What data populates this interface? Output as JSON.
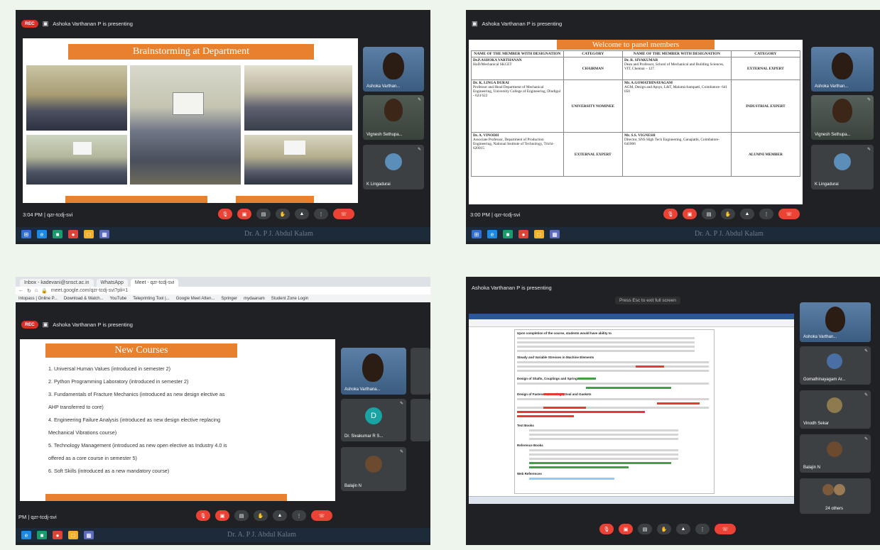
{
  "panel1": {
    "rec_label": "REC",
    "presenting": "Ashoka Varthanan P is presenting",
    "slide_title": "Brainstorming at Department",
    "participants": [
      {
        "name": "Ashoka Varthan..."
      },
      {
        "name": "Vignesh Sethupa..."
      },
      {
        "name": "K Lingadurai"
      }
    ],
    "time": "3:04 PM",
    "meeting_code": "qzr-tcdj-svi",
    "watermark": "Dr. A. P J. Abdul Kalam"
  },
  "panel2": {
    "presenting": "Ashoka Varthanan P is presenting",
    "slide_title": "Welcome to panel members",
    "headers": [
      "NAME OF THE MEMBER WITH DESIGNATION",
      "CATEGORY",
      "NAME OF THE MEMBER WITH DESIGNATION",
      "CATEGORY"
    ],
    "rows": [
      {
        "n1": "Dr.P.ASHOKA VARTHANAN",
        "d1": "HoD/Mechanical SKCET",
        "c1": "CHAIRMAN",
        "n2": "Dr. R. SIVAKUMAR",
        "d2": "Dean and Professor, School of Mechanical and Building Sciences, VIT, Chennai – 127.",
        "c2": "EXTERNAL EXPERT"
      },
      {
        "n1": "Dr. K. LINGA DURAI",
        "d1": "Professor and Head Department of Mechanical Engineering, University College of Engineering, Dindigul - 624 622",
        "c1": "UNIVERSITY NOMINEE",
        "n2": "Mr. A.GOMATHINAYAGAM",
        "d2": "AGM, Design and Apsys, L&T, Malumichampatti, Coimbatore- 641 050",
        "c2": "INDUSTRIAL EXPERT"
      },
      {
        "n1": "Dr. A. VINODH",
        "d1": "Associate Professor, Department of Production Engineering, National Institute of Technology, Trichi-620015",
        "c1": "EXTERNAL EXPERT",
        "n2": "Mr. S.S. VIGNESH",
        "d2": "Director, SNS High Tech Engineering, Ganapathi, Coimbatore- 641006",
        "c2": "ALUMNI MEMBER"
      }
    ],
    "participants": [
      {
        "name": "Ashoka Varthan..."
      },
      {
        "name": "Vignesh Sethupa..."
      },
      {
        "name": "K Lingadurai"
      }
    ],
    "time": "3:00 PM",
    "meeting_code": "qzr-tcdj-svi",
    "watermark": "Dr. A. P J. Abdul Kalam"
  },
  "panel3": {
    "tabs": [
      "Inbox - kadevani@snsct.ac.in",
      "WhatsApp",
      "Meet - qzr-tcdj-svi"
    ],
    "url": "meet.google.com/qzr-tcdj-svi?pli=1",
    "bookmarks": [
      "Intopass | Online P...",
      "Download & Watch...",
      "YouTube",
      "Teleprinting Tool |...",
      "Google Meet Atten...",
      "Springer",
      "mydaanam",
      "Student Zone Login"
    ],
    "rec_label": "REC",
    "presenting": "Ashoka Varthanan P is presenting",
    "slide_title": "New Courses",
    "courses": [
      "1.   Universal Human Values (introduced in semester 2)",
      "2.   Python Programming Laboratory (introduced in semester 2)",
      "3.   Fundamentals of Fracture Mechanics (introduced as new design elective as",
      "       AHP transferred to core)",
      "4.   Engineering Failure Analysis (introduced as new design elective replacing",
      "       Mechanical Vibrations course)",
      "5.   Technology Management (introduced as new open elective as Industry 4.0 is",
      "       offered as a core course in semester 5)",
      "6.   Soft Skills (introduced as a new mandatory course)"
    ],
    "participants": [
      {
        "name": "Ashoka Varthana..."
      },
      {
        "name": "Dr. Sivakumar R S..."
      },
      {
        "name": "Balajin N"
      }
    ],
    "avatar_letter": "D",
    "time": "PM",
    "meeting_code": "qzr-tcdj-svi",
    "watermark": "Dr. A. P J. Abdul Kalam"
  },
  "panel4": {
    "presenting": "Ashoka Varthanan P is presenting",
    "fullscreen_hint": "Press Esc to exit full screen",
    "participants": [
      {
        "name": "Ashoka Varthan..."
      },
      {
        "name": "Gomathinayagam Ar..."
      },
      {
        "name": "Vinodh Sekar"
      },
      {
        "name": "Balajin N"
      },
      {
        "name": "24 others"
      }
    ],
    "doc_lines": [
      "Upon completion of the course, students would have ability to",
      "Steady and Variable Stresses in Machine Elements",
      "Design of Shafts, Couplings and Springs",
      "Design of Fasteners, Bearings, Seal and Gaskets",
      "Text Books",
      "Reference Books",
      "Web References"
    ]
  },
  "colors": {
    "page_bg": "#eef5ec",
    "meet_dark": "#202124",
    "accent_orange": "#e8812e",
    "end_call_red": "#ea4335"
  }
}
